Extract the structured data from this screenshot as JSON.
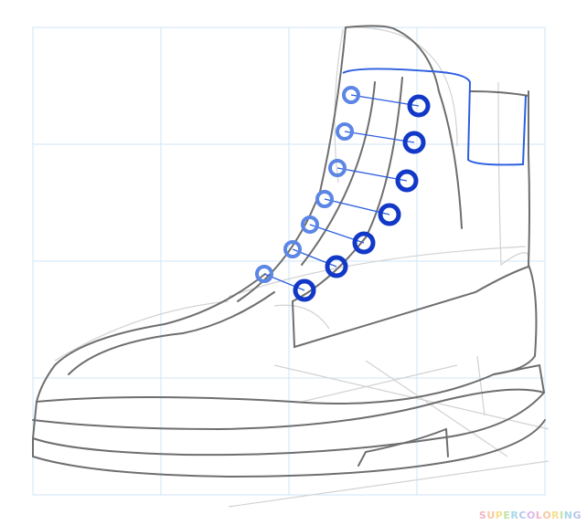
{
  "watermark": {
    "text": "SUPERCOLORING",
    "colors": [
      "#f2b3c6",
      "#f7c9a3",
      "#f5e08f",
      "#bfe3a8",
      "#a8d8e8",
      "#b8c4ee",
      "#d8b8ee"
    ]
  },
  "colors": {
    "grid": "#cfe6f5",
    "sketch_light": "#c8c8c8",
    "sketch_dark": "#6a6a6a",
    "eyelet_light": "#5b86e5",
    "eyelet_dark": "#1238c8",
    "lace_line": "#2d5ee0"
  },
  "icons": {
    "drawing": "boot-sketch-illustration"
  }
}
